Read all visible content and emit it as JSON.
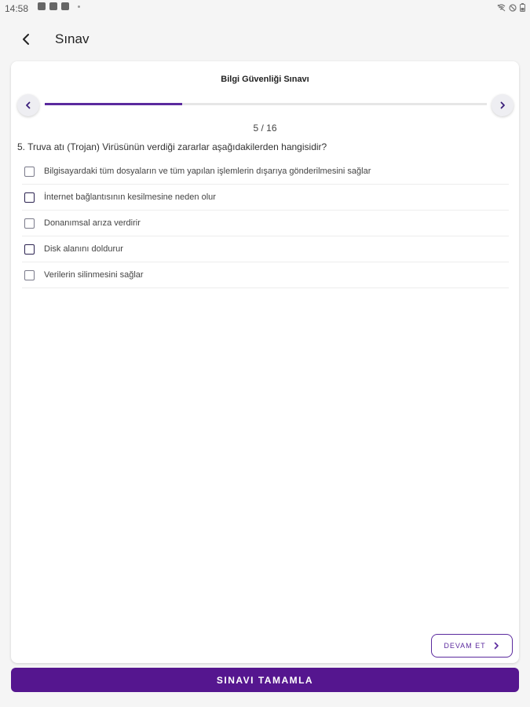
{
  "status_bar": {
    "time": "14:58",
    "left_icons": [
      "image-icon",
      "youtube-icon",
      "bag-icon",
      "dot-icon"
    ],
    "right_icons": [
      "wifi-off-icon",
      "dnd-icon",
      "battery-icon"
    ]
  },
  "app_bar": {
    "title": "Sınav"
  },
  "quiz": {
    "title": "Bilgi Güvenliği Sınavı",
    "counter": "5 / 16",
    "progress": 0.31,
    "question": "5. Truva atı (Trojan) Virüsünün verdiği zararlar aşağıdakilerden hangisidir?",
    "options": [
      "Bilgisayardaki tüm dosyaların ve tüm yapılan işlemlerin dışarıya gönderilmesini sağlar",
      "İnternet bağlantısının kesilmesine neden olur",
      "Donanımsal arıza verdirir",
      "Disk alanını doldurur",
      "Verilerin silinmesini sağlar"
    ]
  },
  "buttons": {
    "continue_label": "DEVAM ET",
    "finish_label": "SINAVI TAMAMLA"
  },
  "colors": {
    "accent": "#5b2a9e",
    "finish_button": "#55168f",
    "background": "#f5f5f5"
  }
}
